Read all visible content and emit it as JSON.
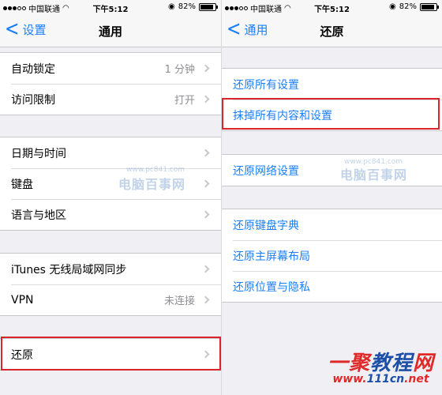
{
  "left": {
    "status": {
      "carrier": "中国联通",
      "time": "下午5:12",
      "battery": "82%",
      "battery_level": 0.82
    },
    "nav": {
      "back_label": "设置",
      "title": "通用"
    },
    "groups": [
      {
        "items": [
          {
            "label": "自动锁定",
            "detail": "1 分钟"
          },
          {
            "label": "访问限制",
            "detail": "打开"
          }
        ]
      },
      {
        "items": [
          {
            "label": "日期与时间"
          },
          {
            "label": "键盘"
          },
          {
            "label": "语言与地区"
          }
        ]
      },
      {
        "items": [
          {
            "label": "iTunes 无线局域网同步"
          },
          {
            "label": "VPN",
            "detail": "未连接"
          }
        ]
      },
      {
        "items": [
          {
            "label": "还原"
          }
        ]
      }
    ]
  },
  "right": {
    "status": {
      "carrier": "中国联通",
      "time": "下午5:12",
      "battery": "82%",
      "battery_level": 0.82
    },
    "nav": {
      "back_label": "通用",
      "title": "还原"
    },
    "groups": [
      {
        "items": [
          {
            "label": "还原所有设置"
          },
          {
            "label": "抹掉所有内容和设置"
          }
        ]
      },
      {
        "items": [
          {
            "label": "还原网络设置"
          }
        ]
      },
      {
        "items": [
          {
            "label": "还原键盘字典"
          },
          {
            "label": "还原主屏幕布局"
          },
          {
            "label": "还原位置与隐私"
          }
        ]
      }
    ]
  },
  "watermark": {
    "text": "电脑百事网",
    "site": "www.pc841.com"
  },
  "brand": {
    "title_a": "一聚",
    "title_b": "教程",
    "title_c": "网",
    "url_a": "www.",
    "url_b": "111cn",
    "url_c": ".net"
  },
  "colors": {
    "accent": "#1a7ffb",
    "highlight": "#d8242a",
    "background": "#efeff4"
  }
}
